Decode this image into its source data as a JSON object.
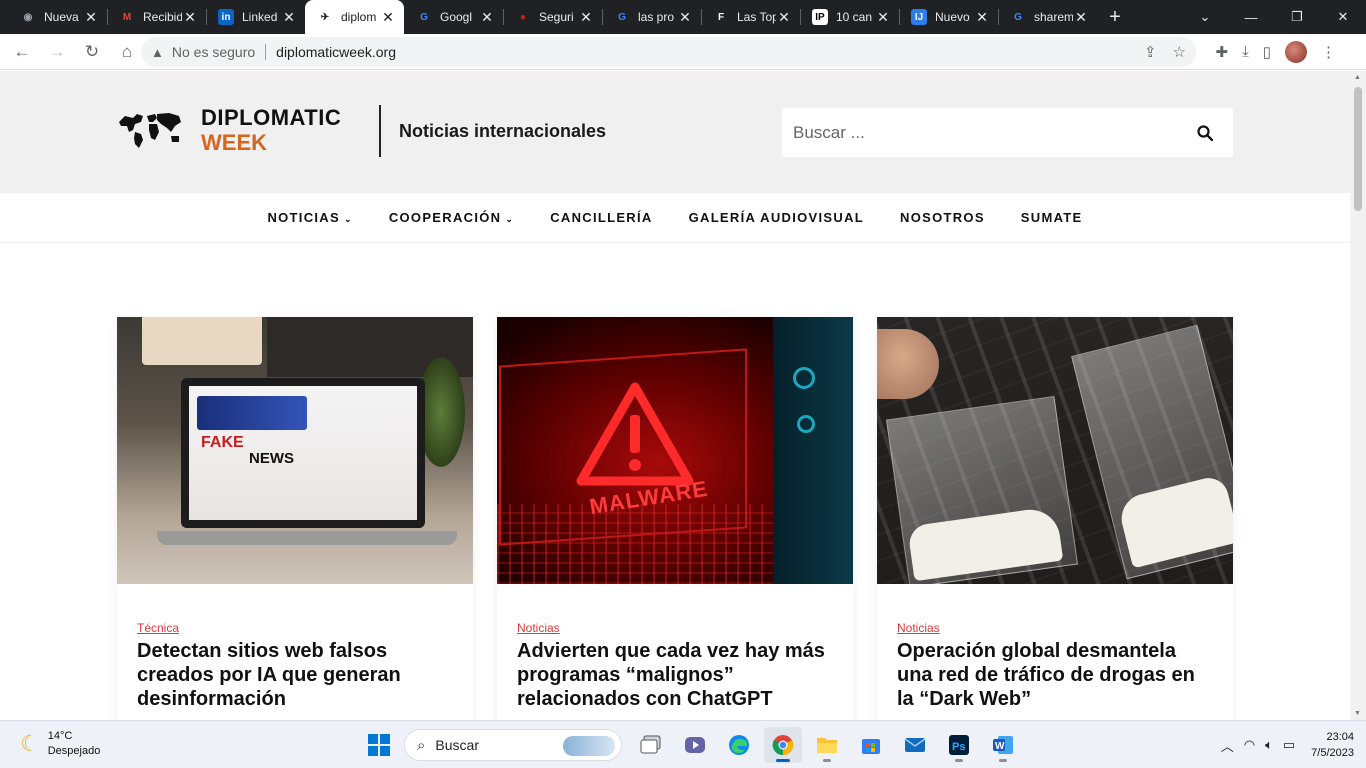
{
  "browser": {
    "tabs": [
      {
        "title": "Nueva",
        "favicon": "chrome-icon",
        "color": "#9aa0a6"
      },
      {
        "title": "Recibid",
        "favicon": "gmail-icon",
        "color": "#ea4335"
      },
      {
        "title": "Linked",
        "favicon": "linkedin-icon",
        "color": "#0a66c2"
      },
      {
        "title": "diplom",
        "favicon": "world-map-icon",
        "color": "#202124",
        "active": true
      },
      {
        "title": "Googl",
        "favicon": "google-icon",
        "color": "#4285f4"
      },
      {
        "title": "Seguri",
        "favicon": "record-icon",
        "color": "#c5221f"
      },
      {
        "title": "las pro",
        "favicon": "google-icon",
        "color": "#4285f4"
      },
      {
        "title": "Las Top",
        "favicon": "forbes-icon",
        "color": "#ffffff"
      },
      {
        "title": "10 can",
        "favicon": "ip-icon",
        "color": "#ffffff"
      },
      {
        "title": "Nuevo",
        "favicon": "news-icon",
        "color": "#2b7de9"
      },
      {
        "title": "sharem",
        "favicon": "google-icon",
        "color": "#4285f4"
      }
    ],
    "security_label": "No es seguro",
    "url": "diplomaticweek.org"
  },
  "site": {
    "logo_word1": "DIPLOMATIC",
    "logo_word2": "WEEK",
    "tagline": "Noticias internacionales",
    "search_placeholder": "Buscar ...",
    "nav": [
      {
        "label": "NOTICIAS",
        "dropdown": true
      },
      {
        "label": "COOPERACIÓN",
        "dropdown": true
      },
      {
        "label": "CANCILLERÍA",
        "dropdown": false
      },
      {
        "label": "GALERÍA AUDIOVISUAL",
        "dropdown": false
      },
      {
        "label": "NOSOTROS",
        "dropdown": false
      },
      {
        "label": "SUMATE",
        "dropdown": false
      }
    ],
    "cards": [
      {
        "category": "Técnica",
        "title": "Detectan sitios web falsos creados por IA que generan desinformación",
        "image_text": [
          "FAKE",
          "NEWS"
        ]
      },
      {
        "category": "Noticias",
        "title": "Advierten que cada vez hay más programas “malignos” relacionados con ChatGPT",
        "image_text": [
          "MALWARE"
        ]
      },
      {
        "category": "Noticias",
        "title": "Operación global desmantela una red de tráfico de drogas en la “Dark Web”",
        "image_text": []
      }
    ]
  },
  "taskbar": {
    "temperature": "14°C",
    "condition": "Despejado",
    "search_label": "Buscar",
    "time": "23:04",
    "date": "7/5/2023",
    "pinned": [
      "start-icon",
      "search",
      "task-view-icon",
      "teams-icon",
      "edge-icon",
      "chrome-icon",
      "file-explorer-icon",
      "store-icon",
      "mail-icon",
      "photoshop-icon",
      "word-icon"
    ]
  }
}
